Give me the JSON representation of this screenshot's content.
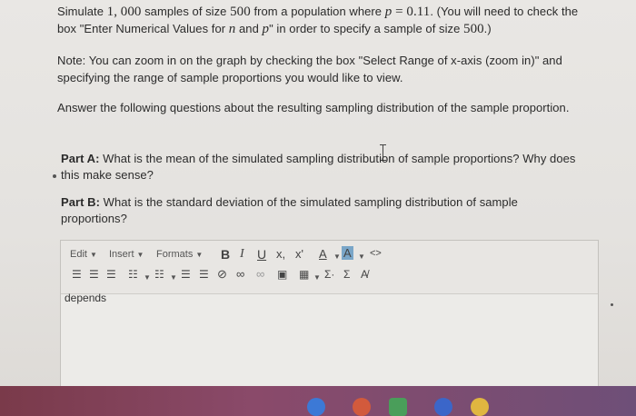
{
  "question": {
    "line1_a": "Simulate ",
    "line1_n": "1, 000",
    "line1_b": " samples of size ",
    "line1_size": "500",
    "line1_c": " from a population where ",
    "line1_p": "p",
    "line1_eq": " = ",
    "line1_pval": "0.11",
    "line1_d": ". (You will need to check the",
    "line2_a": "box \"Enter Numerical Values for ",
    "line2_n": "n",
    "line2_b": " and ",
    "line2_p": "p",
    "line2_c": "\" in order to specify a sample of size ",
    "line2_size": "500",
    "line2_d": ".)",
    "note_line1": "Note: You can zoom in on the graph by checking the box \"Select Range of x-axis (zoom in)\" and",
    "note_line2": "specifying the range of sample proportions you would like to view.",
    "answer_line": "Answer the following questions about the resulting sampling distribution of the sample proportion."
  },
  "partA": {
    "label": "Part A:",
    "line1": " What is the mean of the simulated sampling distribution of sample proportions? Why does",
    "line2": "this make sense?"
  },
  "partB": {
    "label": "Part B:",
    "line1": " What is the standard deviation of the simulated sampling distribution of sample",
    "line2": "proportions?"
  },
  "editor": {
    "menu_edit": "Edit",
    "menu_insert": "Insert",
    "menu_formats": "Formats",
    "btn_bold": "B",
    "btn_italic": "I",
    "btn_underline": "U",
    "btn_subscript": "x,",
    "btn_superscript": "x'",
    "btn_font_color": "A",
    "btn_bg_color": "A",
    "btn_code": "<>",
    "btn_sum_sup": "Σ·",
    "btn_sum": "Σ",
    "btn_spell": "A̸",
    "content": "depends"
  },
  "colors": {
    "accent_bg_color_button": "#7aa6c8",
    "taskbar": "#7a3a4a"
  }
}
